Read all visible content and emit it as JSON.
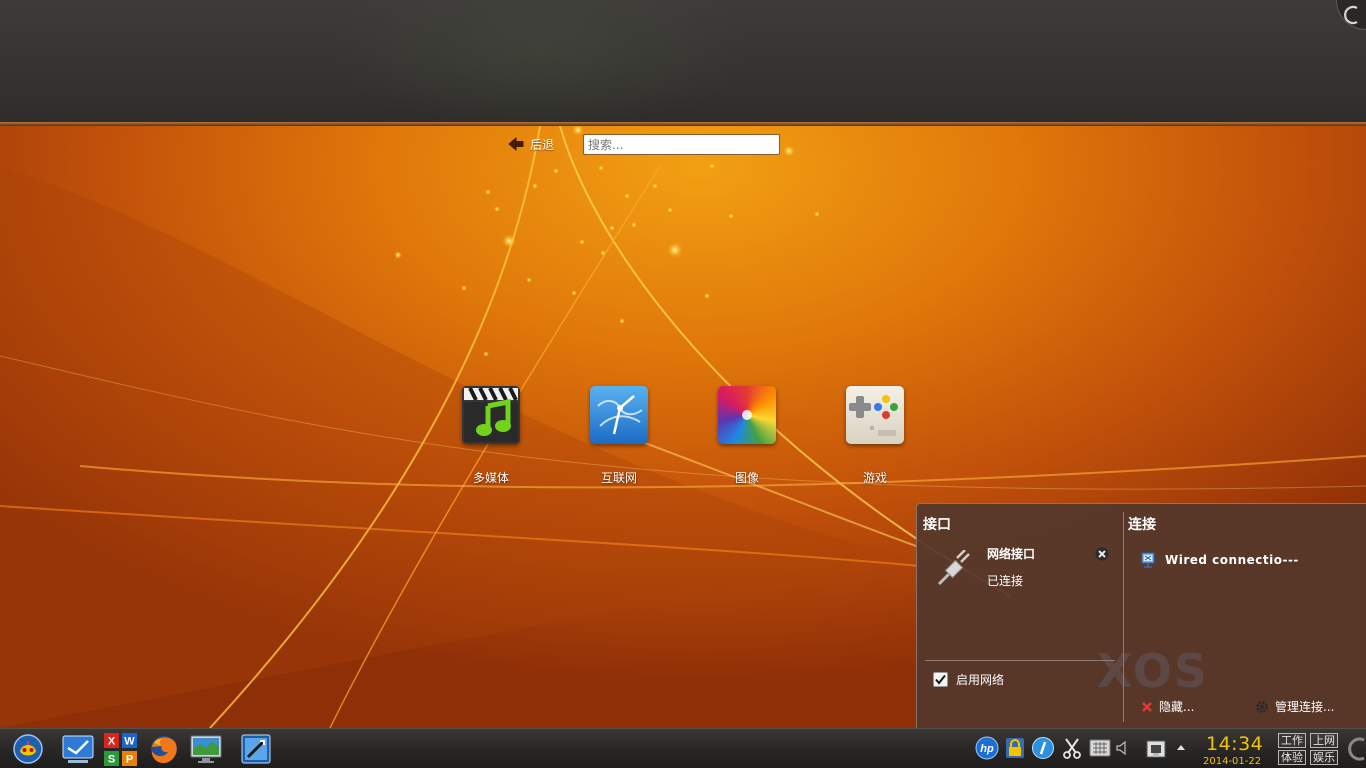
{
  "navigation": {
    "back_label": "后退",
    "search_placeholder": "搜索..."
  },
  "launchers": [
    {
      "label": "多媒体",
      "icon": "multimedia-icon"
    },
    {
      "label": "互联网",
      "icon": "internet-icon"
    },
    {
      "label": "图像",
      "icon": "graphics-icon"
    },
    {
      "label": "游戏",
      "icon": "games-icon"
    }
  ],
  "network_popup": {
    "interfaces_title": "接口",
    "connections_title": "连接",
    "interface": {
      "name": "网络接口",
      "status": "已连接"
    },
    "connection": {
      "name": "Wired  connectio---"
    },
    "enable_network": {
      "label": "启用网络",
      "checked": true
    },
    "hide_label": "隐藏...",
    "manage_label": "管理连接...",
    "watermark": "XOS"
  },
  "taskbar": {
    "apps": [
      {
        "icon": "start-menu-icon"
      },
      {
        "icon": "desktop-icon"
      },
      {
        "icon": "wps-office-icon",
        "letters": [
          "X",
          "W",
          "S",
          "P"
        ]
      },
      {
        "icon": "firefox-icon"
      },
      {
        "icon": "monitor-icon"
      },
      {
        "icon": "screenshot-app-icon"
      }
    ],
    "tray": {
      "icons": [
        "hp-icon",
        "lock-icon",
        "info-icon",
        "scissors-icon",
        "keyboard-icon",
        "volume-icon",
        "network-icon",
        "tray-expand-icon"
      ],
      "hp_text": "hp"
    },
    "clock": {
      "time": "14:34",
      "date": "2014-01-22"
    },
    "modes": [
      "工作",
      "上网",
      "体验",
      "娱乐"
    ]
  },
  "colors": {
    "accent_orange": "#e0780a",
    "clock_yellow": "#f2c400",
    "popup_bg": "#54382c"
  }
}
